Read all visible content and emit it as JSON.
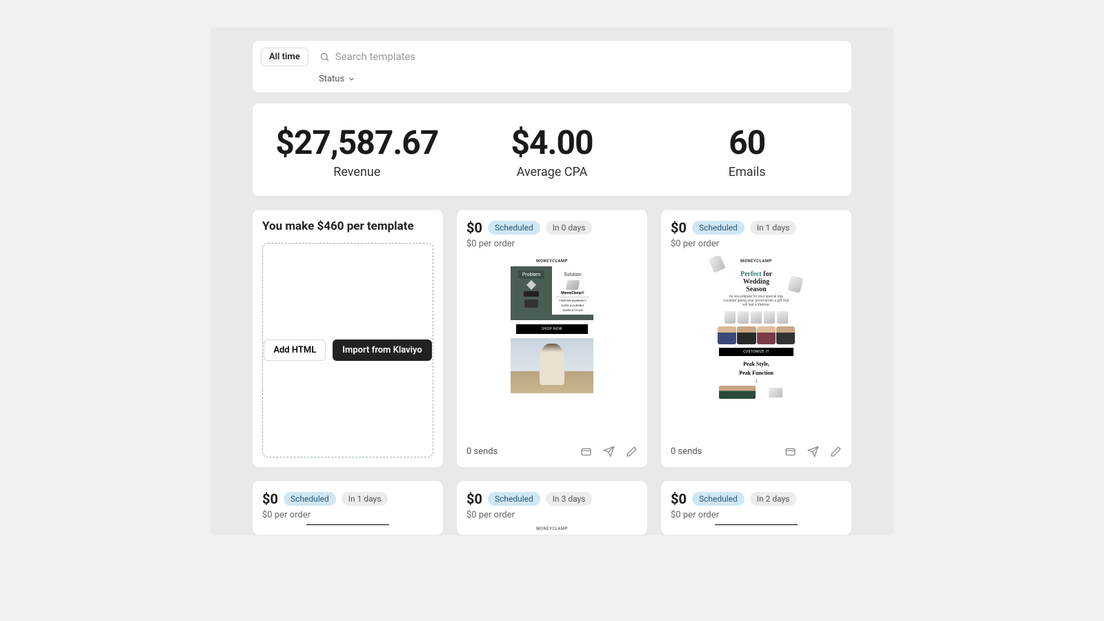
{
  "filters": {
    "time_pill": "All time",
    "search_placeholder": "Search templates",
    "status_label": "Status"
  },
  "stats": {
    "revenue": {
      "value": "$27,587.67",
      "label": "Revenue"
    },
    "cpa": {
      "value": "$4.00",
      "label": "Average CPA"
    },
    "emails": {
      "value": "60",
      "label": "Emails"
    }
  },
  "make_card": {
    "title": "You make $460 per template",
    "add_html": "Add HTML",
    "import": "Import from Klaviyo"
  },
  "cards": {
    "c1": {
      "amount": "$0",
      "status": "Scheduled",
      "days": "In 0 days",
      "per": "$0 per order",
      "sends": "0 sends",
      "thumb": {
        "logo": "MONEYCLAMP",
        "left_tab": "Problem",
        "right_tab": "Solution",
        "brand": "MoneyClamp®",
        "f1": "FOREVER WARRANTY",
        "f2": "SLEEK & DURABLE",
        "f3": "SUPER STYLISH",
        "shop": "SHOP NOW"
      }
    },
    "c2": {
      "amount": "$0",
      "status": "Scheduled",
      "days": "In 1 days",
      "per": "$0 per order",
      "sends": "0 sends",
      "thumb": {
        "logo": "MONEYCLAMP",
        "t1a": "Perfect",
        "t1b": " for",
        "t2": "Wedding",
        "t3": "Season",
        "sub": "As you prepare for your special day, consider giving your groomsmen a gift that will last a lifetime.",
        "cust": "CUSTOMIZE IT",
        "p1": "Peak Style,",
        "p2": "Peak Function"
      }
    },
    "r2a": {
      "amount": "$0",
      "status": "Scheduled",
      "days": "In 1 days",
      "per": "$0 per order"
    },
    "r2b": {
      "amount": "$0",
      "status": "Scheduled",
      "days": "In 3 days",
      "per": "$0 per order",
      "logo": "MONEYCLAMP"
    },
    "r2c": {
      "amount": "$0",
      "status": "Scheduled",
      "days": "In 2 days",
      "per": "$0 per order"
    }
  }
}
